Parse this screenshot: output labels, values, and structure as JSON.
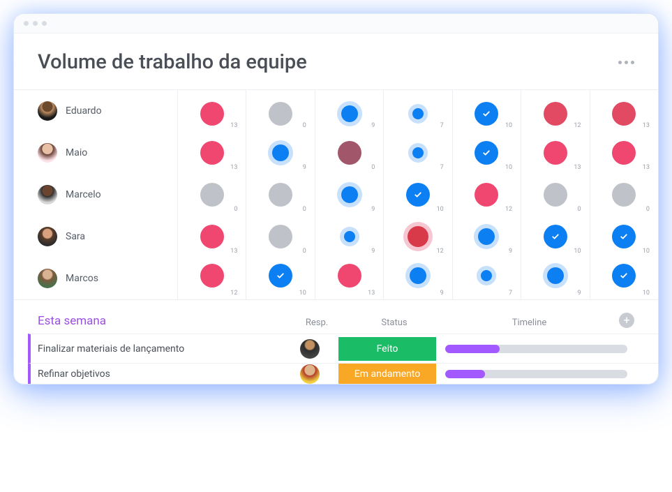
{
  "header": {
    "title": "Volume de trabalho da equipe"
  },
  "members": [
    {
      "name": "Eduardo",
      "avatar_class": "av-eduardo",
      "cells": [
        {
          "color": "c-pink",
          "size": 34,
          "ring": "",
          "check": false,
          "value": 13
        },
        {
          "color": "c-gray",
          "size": 34,
          "ring": "",
          "check": false,
          "value": 0
        },
        {
          "color": "c-blue",
          "size": 24,
          "ring": "ringed",
          "check": false,
          "value": 9
        },
        {
          "color": "c-blue",
          "size": 16,
          "ring": "ringed",
          "check": false,
          "value": 7
        },
        {
          "color": "c-blue",
          "size": 34,
          "ring": "",
          "check": true,
          "value": 10
        },
        {
          "color": "c-pink2",
          "size": 34,
          "ring": "",
          "check": false,
          "value": 12
        },
        {
          "color": "c-pink2",
          "size": 34,
          "ring": "",
          "check": false,
          "value": 13
        }
      ]
    },
    {
      "name": "Maio",
      "avatar_class": "av-maio",
      "cells": [
        {
          "color": "c-pink",
          "size": 34,
          "ring": "",
          "check": false,
          "value": 13
        },
        {
          "color": "c-blue",
          "size": 24,
          "ring": "ringed",
          "check": false,
          "value": 9
        },
        {
          "color": "c-mauve",
          "size": 34,
          "ring": "",
          "check": false,
          "value": 0
        },
        {
          "color": "c-blue",
          "size": 16,
          "ring": "ringed",
          "check": false,
          "value": 7
        },
        {
          "color": "c-blue",
          "size": 34,
          "ring": "",
          "check": true,
          "value": 10
        },
        {
          "color": "c-pink",
          "size": 34,
          "ring": "",
          "check": false,
          "value": 13
        },
        {
          "color": "c-pink",
          "size": 34,
          "ring": "",
          "check": false,
          "value": 13
        }
      ]
    },
    {
      "name": "Marcelo",
      "avatar_class": "av-marcelo",
      "cells": [
        {
          "color": "c-gray",
          "size": 34,
          "ring": "",
          "check": false,
          "value": 0
        },
        {
          "color": "c-gray",
          "size": 34,
          "ring": "",
          "check": false,
          "value": 0
        },
        {
          "color": "c-blue",
          "size": 24,
          "ring": "ringed",
          "check": false,
          "value": 9
        },
        {
          "color": "c-blue",
          "size": 34,
          "ring": "",
          "check": true,
          "value": 10
        },
        {
          "color": "c-pink",
          "size": 34,
          "ring": "",
          "check": false,
          "value": 12
        },
        {
          "color": "c-gray",
          "size": 34,
          "ring": "",
          "check": false,
          "value": 0
        },
        {
          "color": "c-gray",
          "size": 34,
          "ring": "",
          "check": false,
          "value": 0
        }
      ]
    },
    {
      "name": "Sara",
      "avatar_class": "av-sara",
      "cells": [
        {
          "color": "c-pink",
          "size": 34,
          "ring": "",
          "check": false,
          "value": 13
        },
        {
          "color": "c-gray",
          "size": 34,
          "ring": "",
          "check": false,
          "value": 0
        },
        {
          "color": "c-blue",
          "size": 16,
          "ring": "ringed",
          "check": false,
          "value": 9
        },
        {
          "color": "c-red2",
          "size": 30,
          "ring": "ringed-pk",
          "check": false,
          "value": 12
        },
        {
          "color": "c-blue",
          "size": 24,
          "ring": "ringed",
          "check": false,
          "value": 9
        },
        {
          "color": "c-blue",
          "size": 34,
          "ring": "",
          "check": true,
          "value": 10
        },
        {
          "color": "c-blue",
          "size": 34,
          "ring": "",
          "check": true,
          "value": 10
        }
      ]
    },
    {
      "name": "Marcos",
      "avatar_class": "av-marcos",
      "cells": [
        {
          "color": "c-pink",
          "size": 34,
          "ring": "",
          "check": false,
          "value": 12
        },
        {
          "color": "c-blue",
          "size": 34,
          "ring": "",
          "check": true,
          "value": 10
        },
        {
          "color": "c-pink",
          "size": 34,
          "ring": "",
          "check": false,
          "value": 13
        },
        {
          "color": "c-blue",
          "size": 24,
          "ring": "ringed",
          "check": false,
          "value": 9
        },
        {
          "color": "c-blue",
          "size": 16,
          "ring": "ringed",
          "check": false,
          "value": 7
        },
        {
          "color": "c-blue",
          "size": 24,
          "ring": "ringed",
          "check": false,
          "value": 9
        },
        {
          "color": "c-blue",
          "size": 34,
          "ring": "",
          "check": true,
          "value": 10
        }
      ]
    }
  ],
  "week": {
    "title": "Esta semana",
    "columns": {
      "resp": "Resp.",
      "status": "Status",
      "timeline": "Timeline"
    },
    "tasks": [
      {
        "name": "Finalizar materiais de lançamento",
        "avatar_class": "av-task1",
        "status_label": "Feito",
        "status_class": "st-done",
        "progress_pct": 30
      },
      {
        "name": "Refinar objetivos",
        "avatar_class": "av-task2",
        "status_label": "Em andamento",
        "status_class": "st-doing",
        "progress_pct": 22
      }
    ]
  }
}
